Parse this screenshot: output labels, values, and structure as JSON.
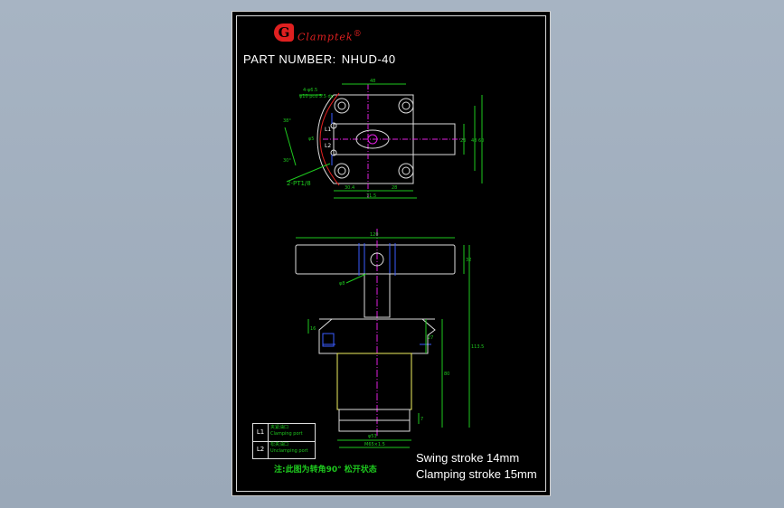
{
  "brand": {
    "logo_letter": "G",
    "name": "Clamptek",
    "registered": "®"
  },
  "part": {
    "label": "PART NUMBER:",
    "value": "NHUD-40"
  },
  "top_view": {
    "dims": {
      "hole_pattern": "4-φ6.5",
      "counterbore": "φ10 pcd 5.5 dp",
      "width_top": "48",
      "angle": "38°",
      "d1": "φ5",
      "d2": "23",
      "d3": "48",
      "d4": "60",
      "bottom_a": "30.4",
      "bottom_b": "28",
      "overall": "71.5",
      "port_angle": "30°",
      "ports": "2-PT1/8"
    },
    "ports": [
      "L1",
      "L2"
    ]
  },
  "side_view": {
    "dims": {
      "arm_length": "120",
      "arm_height": "32",
      "pin": "φ8",
      "body_top": "27",
      "mid": "80",
      "overall": "113.5",
      "side": "16",
      "base_dia": "φ53",
      "thread": "M65×1.5",
      "bottom": "7"
    }
  },
  "legend": [
    {
      "code": "L1",
      "cn": "夹紧油口",
      "en": "Clamping port"
    },
    {
      "code": "L2",
      "cn": "松夹油口",
      "en": "Unclamping port"
    }
  ],
  "note": "注:此图为转角90°  松开状态",
  "specs": {
    "swing": "Swing stroke 14mm",
    "clamping": "Clamping stroke 15mm"
  },
  "colors": {
    "frame": "#000000",
    "cad_red": "#e02020",
    "cad_green": "#1ec81e",
    "cad_magenta": "#e020e0",
    "cad_blue": "#3a5cff",
    "cad_yellow": "#f0f060"
  }
}
